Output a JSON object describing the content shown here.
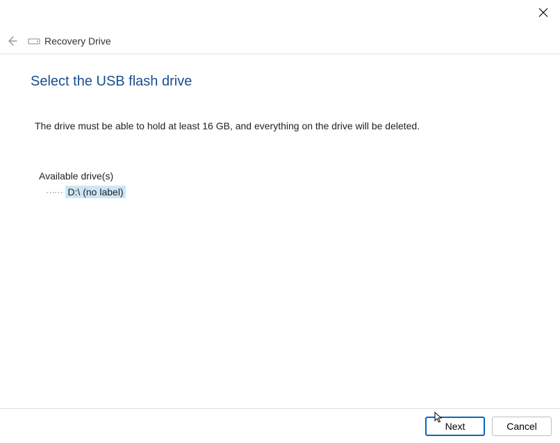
{
  "window": {
    "title": "Recovery Drive"
  },
  "page": {
    "heading": "Select the USB flash drive",
    "instructions": "The drive must be able to hold at least 16 GB, and everything on the drive will be deleted."
  },
  "drives": {
    "label": "Available drive(s)",
    "items": [
      {
        "text": "D:\\ (no label)",
        "selected": true
      }
    ]
  },
  "buttons": {
    "next": "Next",
    "cancel": "Cancel"
  }
}
